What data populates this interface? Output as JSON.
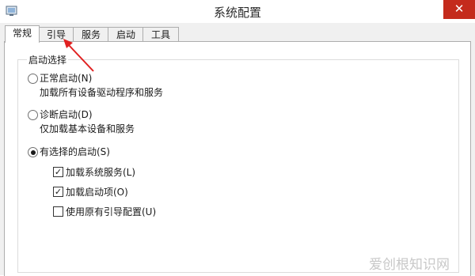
{
  "window": {
    "title": "系统配置",
    "close_glyph": "✕",
    "app_icon": "system-config-icon",
    "close_color": "#c42b1c"
  },
  "tabs": [
    {
      "label": "常规",
      "active": true
    },
    {
      "label": "引导",
      "active": false
    },
    {
      "label": "服务",
      "active": false
    },
    {
      "label": "启动",
      "active": false
    },
    {
      "label": "工具",
      "active": false
    }
  ],
  "startup_group": {
    "legend": "启动选择",
    "normal": {
      "label": "正常启动(N)",
      "desc": "加载所有设备驱动程序和服务",
      "checked": false
    },
    "diagnostic": {
      "label": "诊断启动(D)",
      "desc": "仅加载基本设备和服务",
      "checked": false
    },
    "selective": {
      "label": "有选择的启动(S)",
      "checked": true,
      "options": [
        {
          "label": "加载系统服务(L)",
          "checked": true
        },
        {
          "label": "加载启动项(O)",
          "checked": true
        },
        {
          "label": "使用原有引导配置(U)",
          "checked": false
        }
      ]
    }
  },
  "watermark": "爱创根知识网",
  "annotation": {
    "arrow_color": "#e02020"
  }
}
